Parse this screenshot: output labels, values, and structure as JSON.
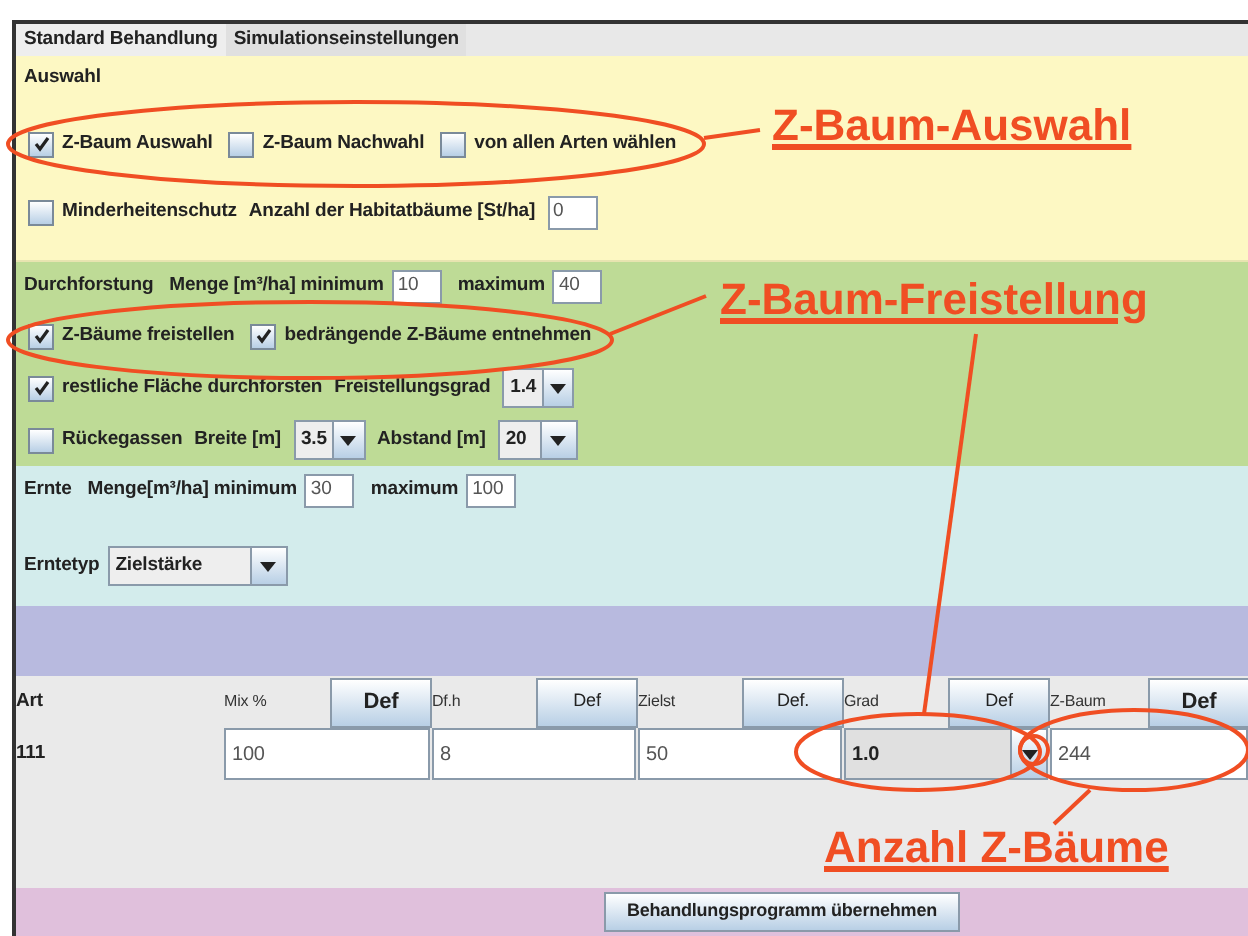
{
  "tabs": [
    {
      "label": "Standard Behandlung",
      "selected": true
    },
    {
      "label": "Simulationseinstellungen",
      "selected": false
    }
  ],
  "auswahl": {
    "title": "Auswahl",
    "checks": [
      {
        "label": "Z-Baum Auswahl",
        "checked": true
      },
      {
        "label": "Z-Baum Nachwahl",
        "checked": false
      },
      {
        "label": "von allen Arten wählen",
        "checked": false
      }
    ],
    "minderheit": {
      "label": "Minderheitenschutz",
      "checked": false
    },
    "habitat_label": "Anzahl der Habitatbäume [St/ha]",
    "habitat_value": "0"
  },
  "durchforstung": {
    "title": "Durchforstung",
    "menge_label": "Menge [m³/ha] minimum",
    "minimum": "10",
    "max_label": "maximum",
    "maximum": "40",
    "checks": [
      {
        "label": "Z-Bäume freistellen",
        "checked": true
      },
      {
        "label": "bedrängende Z-Bäume entnehmen",
        "checked": true
      }
    ],
    "rest": {
      "label": "restliche Fläche durchforsten",
      "checked": true
    },
    "grad_label": "Freistellungsgrad",
    "grad_value": "1.4",
    "rueckegassen": {
      "label": "Rückegassen",
      "checked": false
    },
    "breite_label": "Breite [m]",
    "breite_value": "3.5",
    "abstand_label": "Abstand [m]",
    "abstand_value": "20"
  },
  "ernte": {
    "title": "Ernte",
    "menge_label": "Menge[m³/ha] minimum",
    "minimum": "30",
    "max_label": "maximum",
    "maximum": "100",
    "typ_label": "Erntetyp",
    "typ_value": "Zielstärke"
  },
  "table": {
    "art_label": "Art",
    "columns": [
      {
        "label": "Mix %",
        "button": "Def",
        "emphasized": true
      },
      {
        "label": "Df.h",
        "button": "Def",
        "emphasized": false
      },
      {
        "label": "Zielst",
        "button": "Def.",
        "emphasized": false
      },
      {
        "label": "Grad",
        "button": "Def",
        "emphasized": false
      },
      {
        "label": "Z-Baum",
        "button": "Def",
        "emphasized": true
      }
    ],
    "rows": [
      {
        "art": "111",
        "cells": [
          {
            "kind": "field",
            "value": "100"
          },
          {
            "kind": "field",
            "value": "8"
          },
          {
            "kind": "field",
            "value": "50"
          },
          {
            "kind": "combo",
            "value": "1.0"
          },
          {
            "kind": "field",
            "value": "244"
          }
        ]
      }
    ]
  },
  "apply_button": "Behandlungsprogramm übernehmen",
  "annotations": [
    "Z-Baum-Auswahl",
    "Z-Baum-Freistellung",
    "Anzahl Z-Bäume"
  ]
}
